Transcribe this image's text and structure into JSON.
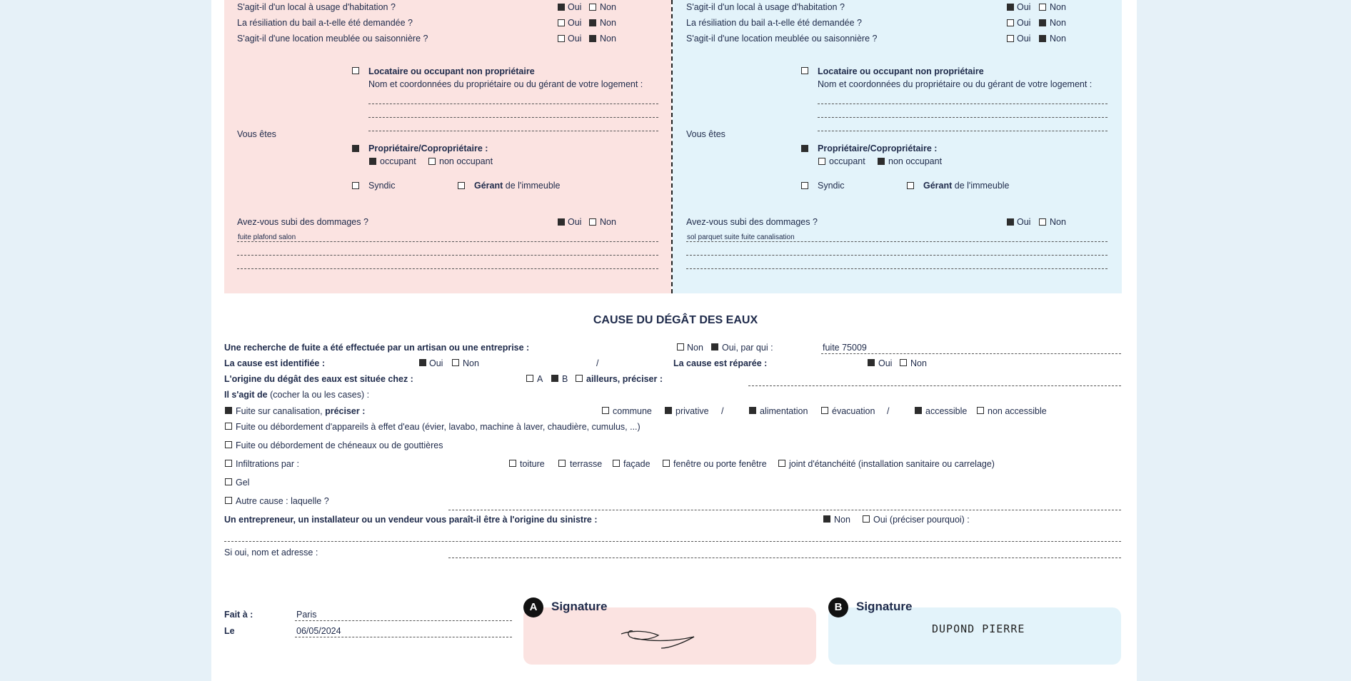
{
  "common": {
    "oui": "Oui",
    "non": "Non"
  },
  "questions": {
    "habitation": "S'agit-il d'un local à usage d'habitation ?",
    "resiliation": "La résiliation du bail a-t-elle été demandée ?",
    "meublee": "S'agit-il d'une location meublée ou saisonnière ?",
    "vous_etes": "Vous êtes",
    "locataire": "Locataire ou occupant non propriétaire",
    "coordonnees": "Nom et coordonnées du propriétaire ou du gérant de votre logement :",
    "proprietaire": "Propriétaire/Copropriétaire :",
    "occupant": "occupant",
    "non_occupant": "non occupant",
    "syndic": "Syndic",
    "gerant": "Gérant",
    "de_immeuble": "de l'immeuble",
    "dommages": "Avez-vous subi des dommages ?"
  },
  "party_a": {
    "dommages_detail": "fuite plafond salon",
    "signature_label": "A"
  },
  "party_b": {
    "dommages_detail": "sol parquet suite fuite canalisation",
    "signature_label": "B",
    "signature_text": "DUPOND PIERRE"
  },
  "cause": {
    "title": "CAUSE DU DÉGÂT DES EAUX",
    "recherche": "Une recherche de fuite a été effectuée par un artisan ou une entreprise :",
    "oui_par_qui": "Oui, par qui :",
    "par_qui_value": "fuite 75009",
    "identifiee": "La cause est identifiée :",
    "slash": "/",
    "reparee": "La cause est réparée :",
    "origine": "L'origine du dégât des eaux est située chez :",
    "opt_a": "A",
    "opt_b": "B",
    "ailleurs": "ailleurs, préciser :",
    "il_sagit_bold": "Il s'agit de",
    "il_sagit_rest": "(cocher la ou les cases) :",
    "fuite_canalisation": "Fuite sur canalisation,",
    "preciser": "préciser :",
    "commune": "commune",
    "privative": "privative",
    "alimentation": "alimentation",
    "evacuation": "évacuation",
    "accessible": "accessible",
    "non_accessible": "non accessible",
    "appareils": "Fuite ou débordement d'appareils à effet d'eau (évier, lavabo, machine à laver, chaudière, cumulus, ...)",
    "cheneaux": "Fuite ou débordement de chéneaux ou de gouttières",
    "infiltrations": "Infiltrations par :",
    "toiture": "toiture",
    "terrasse": "terrasse",
    "facade": "façade",
    "fenetre": "fenêtre ou porte fenêtre",
    "joint": "joint d'étanchéité (installation sanitaire ou carrelage)",
    "gel": "Gel",
    "autre": "Autre cause : laquelle ?",
    "entrepreneur": "Un entrepreneur, un installateur ou un vendeur vous paraît-il être à l'origine du sinistre :",
    "oui_preciser": "Oui (préciser pourquoi) :",
    "si_oui": "Si oui, nom et adresse :"
  },
  "footer": {
    "fait_a": "Fait à :",
    "fait_a_value": "Paris",
    "le": "Le",
    "le_value": "06/05/2024",
    "signature": "Signature"
  }
}
